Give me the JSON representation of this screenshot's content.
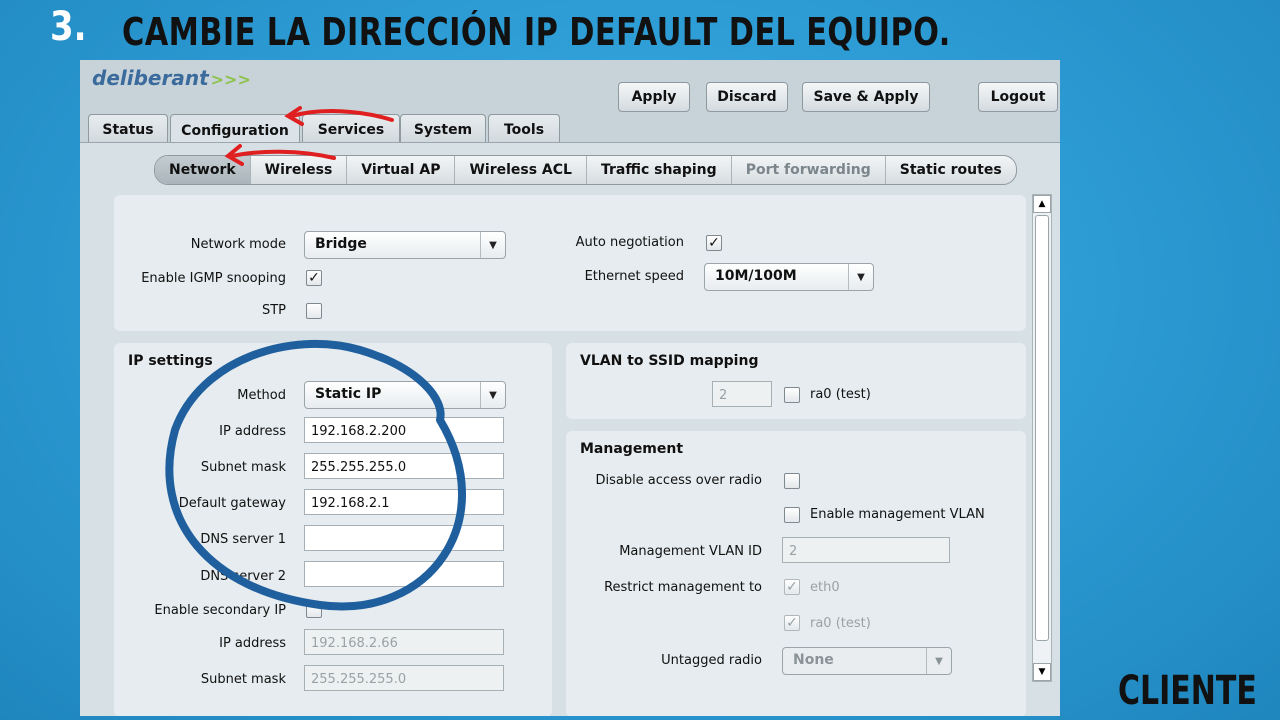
{
  "slide": {
    "step_number": "3.",
    "step_title": "Cambie la dirección IP default del equipo.",
    "footer_label": "Cliente"
  },
  "app": {
    "brand": "deliberant",
    "brand_mark": ">>>",
    "buttons": {
      "apply": "Apply",
      "discard": "Discard",
      "save_apply": "Save & Apply",
      "logout": "Logout"
    },
    "tabs": [
      "Status",
      "Configuration",
      "Services",
      "System",
      "Tools"
    ],
    "active_tab": "Configuration",
    "subtabs": [
      "Network",
      "Wireless",
      "Virtual AP",
      "Wireless ACL",
      "Traffic shaping",
      "Port forwarding",
      "Static routes"
    ],
    "active_subtab": "Network",
    "disabled_subtab": "Port forwarding"
  },
  "general": {
    "network_mode_label": "Network mode",
    "network_mode_value": "Bridge",
    "igmp_label": "Enable IGMP snooping",
    "igmp_checked": "✓",
    "stp_label": "STP",
    "auto_neg_label": "Auto negotiation",
    "auto_neg_checked": "✓",
    "eth_speed_label": "Ethernet speed",
    "eth_speed_value": "10M/100M"
  },
  "ip_settings": {
    "title": "IP settings",
    "method_label": "Method",
    "method_value": "Static IP",
    "ip_label": "IP address",
    "ip_value": "192.168.2.200",
    "mask_label": "Subnet mask",
    "mask_value": "255.255.255.0",
    "gateway_label": "Default gateway",
    "gateway_value": "192.168.2.1",
    "dns1_label": "DNS server 1",
    "dns1_value": "",
    "dns2_label": "DNS server 2",
    "dns2_value": "",
    "secondary_label": "Enable secondary IP",
    "sec_ip_label": "IP address",
    "sec_ip_value": "192.168.2.66",
    "sec_mask_label": "Subnet mask",
    "sec_mask_value": "255.255.255.0"
  },
  "vlan": {
    "title": "VLAN to SSID mapping",
    "vlan_value": "2",
    "ssid_label": "ra0 (test)"
  },
  "management": {
    "title": "Management",
    "disable_radio_label": "Disable access over radio",
    "enable_vlan_label": "Enable management VLAN",
    "vlan_id_label": "Management VLAN ID",
    "vlan_id_value": "2",
    "restrict_label": "Restrict management to",
    "restrict_eth": "eth0",
    "restrict_ra": "ra0 (test)",
    "check_mark": "✓",
    "untagged_label": "Untagged radio",
    "untagged_value": "None"
  },
  "icons": {
    "dropdown": "▼",
    "scroll_up": "▲",
    "scroll_down": "▼"
  },
  "colors": {
    "background": "#2e9dd6",
    "annotation_red": "#e02020",
    "annotation_blue": "#1f5f9e"
  }
}
